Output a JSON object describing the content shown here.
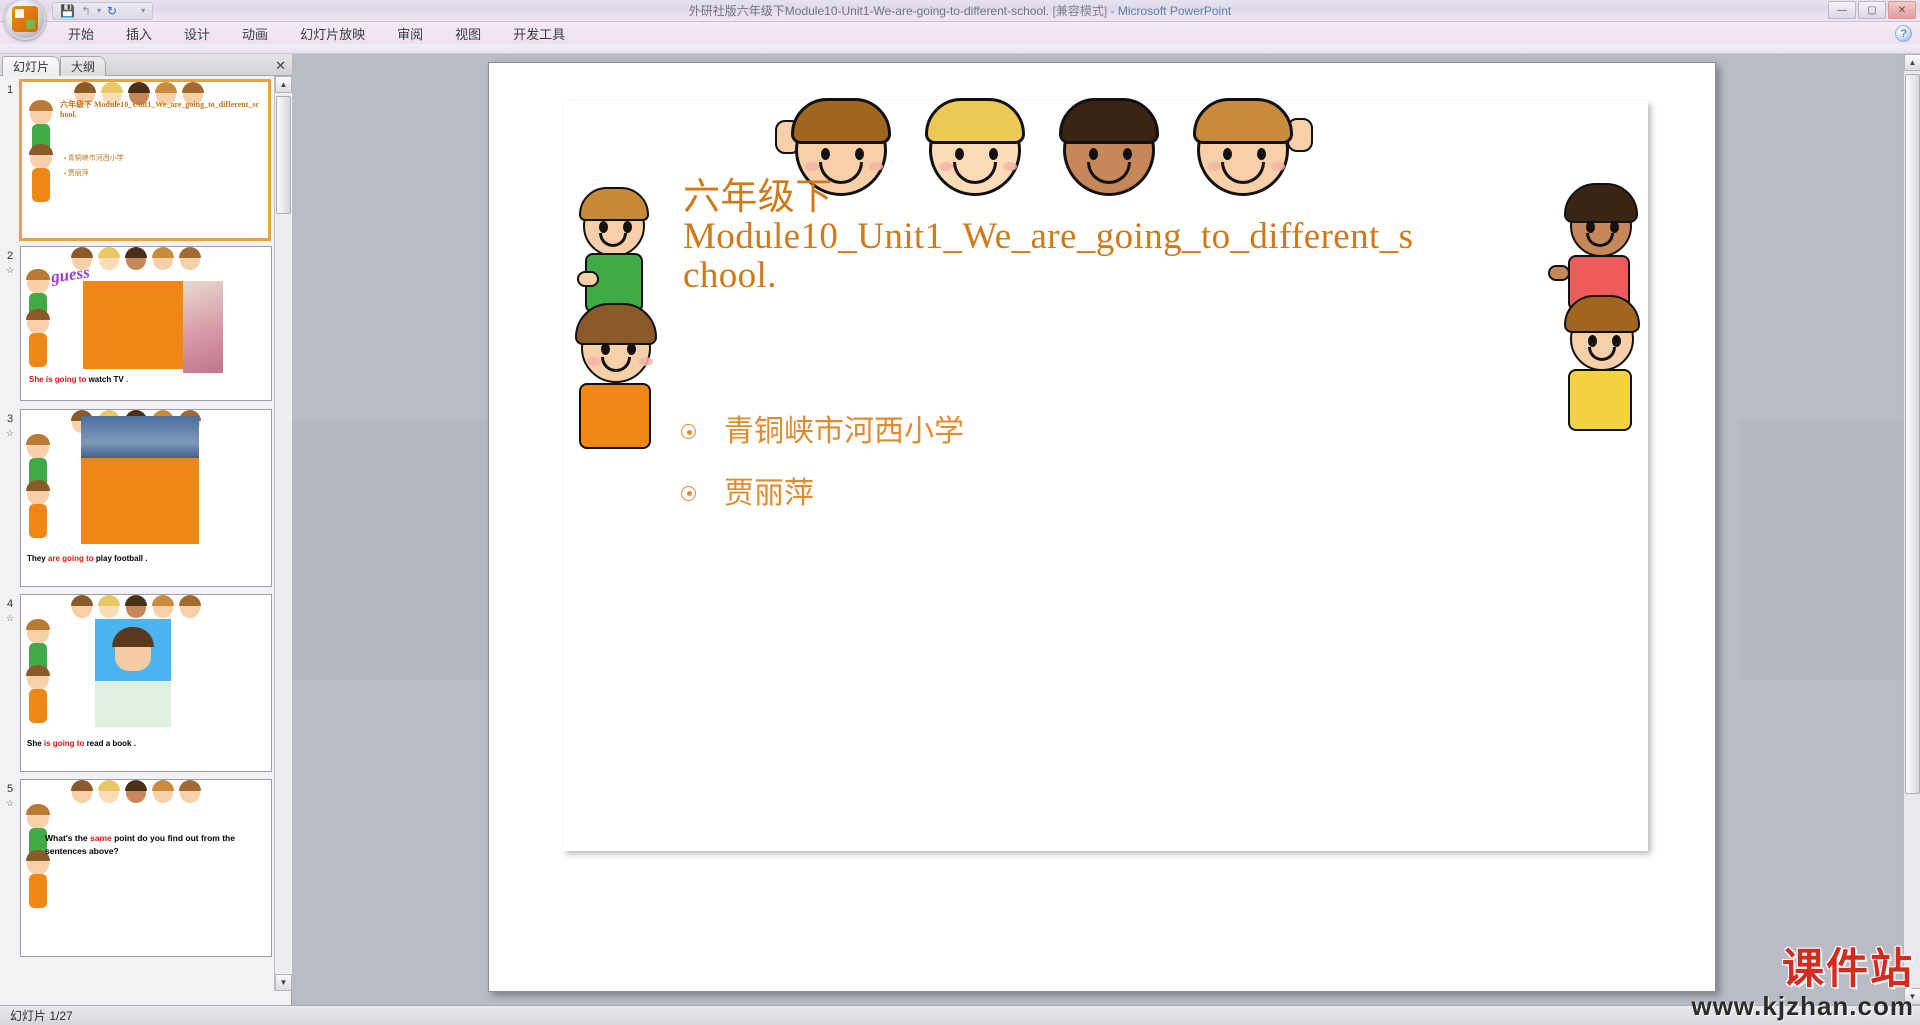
{
  "window": {
    "title_doc": "外研社版六年级下Module10-Unit1-We-are-going-to-different-school.",
    "title_mode": "[兼容模式]",
    "title_sep": "-",
    "title_app": "Microsoft PowerPoint",
    "minimize": "—",
    "maximize": "▢",
    "close": "✕",
    "help": "?"
  },
  "quick_access": {
    "office_orb": "office-orb",
    "save": "💾",
    "undo": "↰",
    "undo_arrow": "▾",
    "redo": "↻",
    "customize": "▾"
  },
  "ribbon": {
    "tabs": [
      {
        "label": "开始"
      },
      {
        "label": "插入"
      },
      {
        "label": "设计"
      },
      {
        "label": "动画"
      },
      {
        "label": "幻灯片放映"
      },
      {
        "label": "审阅"
      },
      {
        "label": "视图"
      },
      {
        "label": "开发工具"
      }
    ]
  },
  "left_panel": {
    "tabs": [
      {
        "label": "幻灯片",
        "active": true
      },
      {
        "label": "大纲",
        "active": false
      }
    ],
    "close_label": "✕",
    "scroll_up": "▲",
    "scroll_down": "▼",
    "slides": [
      {
        "number": "1",
        "title": "六年级下 Module10_Unit1_We_are_going_to_different_school.",
        "bullets": [
          "青铜峡市河西小学",
          "贾丽萍"
        ],
        "selected": true
      },
      {
        "number": "2",
        "anim": "☆",
        "word": "guess",
        "caption_parts": [
          {
            "text": "She is going to",
            "color": "red"
          },
          {
            "text": " watch TV",
            "color": "black"
          },
          {
            "text": " .",
            "color": "red"
          }
        ]
      },
      {
        "number": "3",
        "anim": "☆",
        "caption_parts": [
          {
            "text": "They ",
            "color": "black"
          },
          {
            "text": "are going to",
            "color": "red"
          },
          {
            "text": "  play football",
            "color": "black"
          },
          {
            "text": " .",
            "color": "black"
          }
        ]
      },
      {
        "number": "4",
        "anim": "☆",
        "caption_parts": [
          {
            "text": "She ",
            "color": "black"
          },
          {
            "text": "is going to",
            "color": "red"
          },
          {
            "text": "  read a book",
            "color": "black"
          },
          {
            "text": " .",
            "color": "black"
          }
        ]
      },
      {
        "number": "5",
        "anim": "☆",
        "caption_parts": [
          {
            "text": "What's the ",
            "color": "black"
          },
          {
            "text": "same",
            "color": "red"
          },
          {
            "text": " point do you find out from the sentences above?",
            "color": "black"
          }
        ]
      }
    ]
  },
  "slide": {
    "title_line1": "六年级下",
    "title_line2": "Module10_Unit1_We_are_going_to_different_s",
    "title_line3": "chool.",
    "bullets": [
      {
        "text": "青铜峡市河西小学"
      },
      {
        "text": "贾丽萍"
      }
    ]
  },
  "watermark": {
    "top": "课件站",
    "bottom": "www.kjzhan.com"
  },
  "status": {
    "text": "幻灯片 1/27"
  },
  "colors": {
    "title_orange": "#cf7a18",
    "bullet_orange": "#e08b2e",
    "accent_orange": "#ef8717",
    "red": "#e11414",
    "watermark_red": "#d32b1e",
    "chrome_violet": "#eee1f1",
    "stage_gray": "#b9bcc5"
  }
}
